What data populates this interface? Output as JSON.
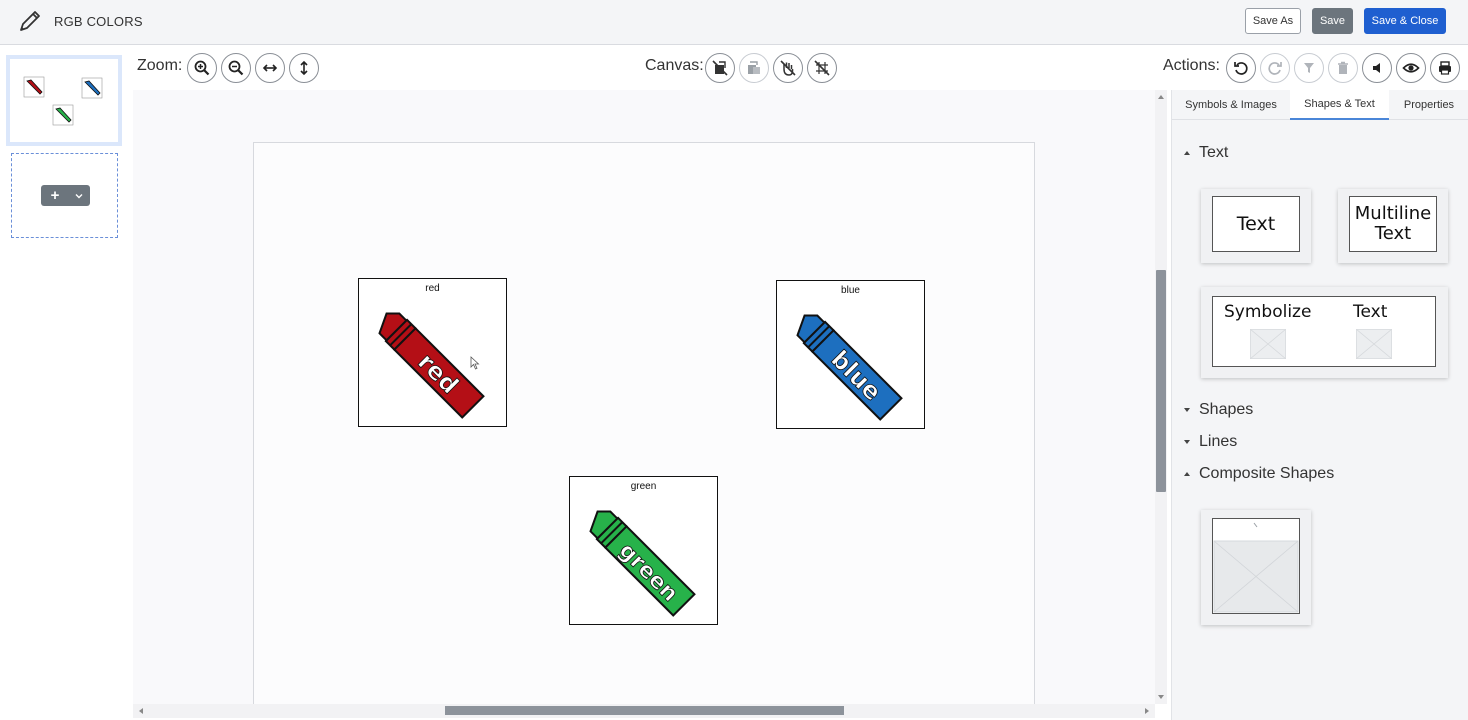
{
  "header": {
    "title": "RGB COLORS",
    "save_as": "Save As",
    "save": "Save",
    "save_close": "Save & Close"
  },
  "toolbar": {
    "zoom_label": "Zoom:",
    "canvas_label": "Canvas:",
    "actions_label": "Actions:"
  },
  "canvas": {
    "cards": [
      {
        "label": "red",
        "word": "red",
        "color": "#b40f16"
      },
      {
        "label": "blue",
        "word": "blue",
        "color": "#1d6fbf"
      },
      {
        "label": "green",
        "word": "green",
        "color": "#27b24a"
      }
    ]
  },
  "pages": {
    "add_label": "+"
  },
  "panel": {
    "tabs": [
      "Symbols & Images",
      "Shapes & Text",
      "Properties"
    ],
    "active_tab": "Shapes & Text",
    "sections": {
      "text": "Text",
      "shapes": "Shapes",
      "lines": "Lines",
      "composite": "Composite Shapes"
    },
    "tiles": {
      "text": "Text",
      "multiline_1": "Multiline",
      "multiline_2": "Text",
      "symbolize": "Symbolize",
      "symbolize_text": "Text"
    }
  },
  "colors": {
    "accent": "#1f5fd0",
    "button_gray": "#6c757d"
  }
}
